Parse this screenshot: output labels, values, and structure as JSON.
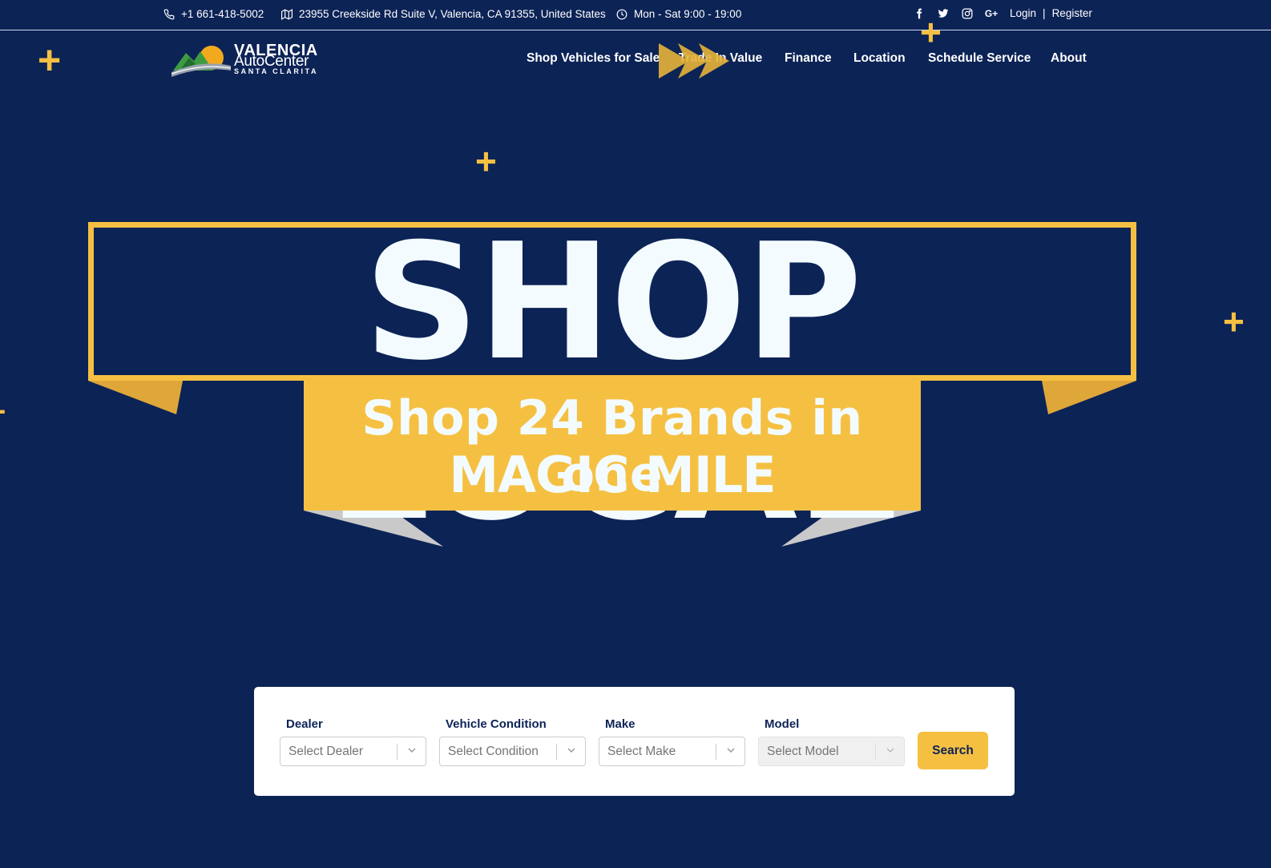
{
  "topbar": {
    "phone": "+1 661-418-5002",
    "address": "23955 Creekside Rd Suite V, Valencia, CA 91355, United States",
    "hours": "Mon - Sat 9:00 - 19:00",
    "login": "Login",
    "separator": "|",
    "register": "Register",
    "social_icons": [
      "facebook-icon",
      "twitter-icon",
      "instagram-icon",
      "google-plus-icon"
    ]
  },
  "logo": {
    "line1": "VALENCIA",
    "line2": "AutoCenter",
    "line3": "SANTA CLARITA"
  },
  "nav": {
    "items": [
      {
        "label": "Shop Vehicles for Sale"
      },
      {
        "label": "Trade In Value"
      },
      {
        "label": "Finance"
      },
      {
        "label": "Location"
      },
      {
        "label": "Schedule Service"
      },
      {
        "label": "About"
      }
    ]
  },
  "hero": {
    "title": "SHOP LOCAL",
    "ribbon_line1": "Shop 24 Brands in one",
    "ribbon_line2": "MAGIC MILE"
  },
  "search": {
    "fields": [
      {
        "label": "Dealer",
        "placeholder": "Select Dealer",
        "disabled": false
      },
      {
        "label": "Vehicle Condition",
        "placeholder": "Select Condition",
        "disabled": false
      },
      {
        "label": "Make",
        "placeholder": "Select Make",
        "disabled": false
      },
      {
        "label": "Model",
        "placeholder": "Select Model",
        "disabled": true
      }
    ],
    "button_label": "Search"
  },
  "colors": {
    "background": "#0c2356",
    "accent": "#f5c042",
    "hero_text": "#f3fbff",
    "ribbon_shadow": "#dfa63a",
    "ribbon_tail": "#c9c9c9"
  }
}
